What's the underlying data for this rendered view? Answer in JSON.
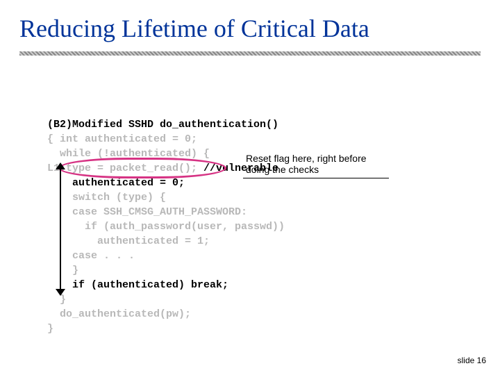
{
  "title": "Reducing Lifetime of Critical Data",
  "annotation": "Reset flag here, right before doing the checks",
  "slide_label": "slide 16",
  "code": {
    "l0": "(B2)Modified SSHD do_authentication()",
    "l1": "{ int authenticated = 0;",
    "l2": "  while (!authenticated) {",
    "l3a": "L1:type = packet_read();",
    "l3b": " //vulnerable",
    "l4": "    authenticated = 0;",
    "l5": "    switch (type) {",
    "l6": "    case SSH_CMSG_AUTH_PASSWORD:",
    "l7": "      if (auth_password(user, passwd))",
    "l8": "        authenticated = 1;",
    "l9": "    case . . .",
    "l10": "    }",
    "l11": "    if (authenticated) break;",
    "l12": "  }",
    "l13": "  do_authenticated(pw);",
    "l14": "}"
  }
}
